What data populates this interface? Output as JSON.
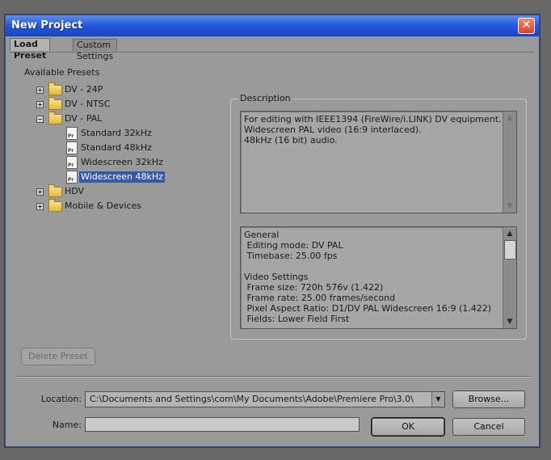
{
  "window": {
    "title": "New Project",
    "close_glyph": "✕"
  },
  "tabs": [
    {
      "label": "Load Preset",
      "active": true
    },
    {
      "label": "Custom Settings",
      "active": false
    }
  ],
  "presets": {
    "title": "Available Presets",
    "tree": [
      {
        "label": "DV - 24P",
        "kind": "folder",
        "expander": "+"
      },
      {
        "label": "DV - NTSC",
        "kind": "folder",
        "expander": "+"
      },
      {
        "label": "DV - PAL",
        "kind": "folder",
        "expander": "−"
      },
      {
        "label": "Standard 32kHz",
        "kind": "preset-file",
        "icon_text": "Pr"
      },
      {
        "label": "Standard 48kHz",
        "kind": "preset-file",
        "icon_text": "Pr"
      },
      {
        "label": "Widescreen 32kHz",
        "kind": "preset-file",
        "icon_text": "Pr"
      },
      {
        "label": "Widescreen 48kHz",
        "kind": "preset-file",
        "icon_text": "Pr",
        "selected": true
      },
      {
        "label": "HDV",
        "kind": "folder",
        "expander": "+"
      },
      {
        "label": "Mobile & Devices",
        "kind": "folder",
        "expander": "+"
      }
    ]
  },
  "description": {
    "group_title": "Description",
    "text": "For editing with IEEE1394 (FireWire/i.LINK) DV equipment.\nWidescreen PAL video (16:9 interlaced).\n48kHz (16 bit) audio.",
    "general": "General\n Editing mode: DV PAL\n Timebase: 25.00 fps\n\nVideo Settings\n Frame size: 720h 576v (1.422)\n Frame rate: 25.00 frames/second\n Pixel Aspect Ratio: D1/DV PAL Widescreen 16:9 (1.422)\n Fields: Lower Field First",
    "scroll_up_glyph": "▲",
    "scroll_down_glyph": "▼"
  },
  "buttons": {
    "delete_preset": "Delete Preset",
    "browse": "Browse...",
    "ok": "OK",
    "cancel": "Cancel"
  },
  "location": {
    "label": "Location:",
    "value": "C:\\Documents and Settings\\com\\My Documents\\Adobe\\Premiere Pro\\3.0\\",
    "arrow_glyph": "▼"
  },
  "name": {
    "label": "Name:",
    "value": ""
  },
  "colors": {
    "titlebar": "#2156d8",
    "dialog_bg": "#9a9a9a",
    "selection": "#3558a8"
  }
}
